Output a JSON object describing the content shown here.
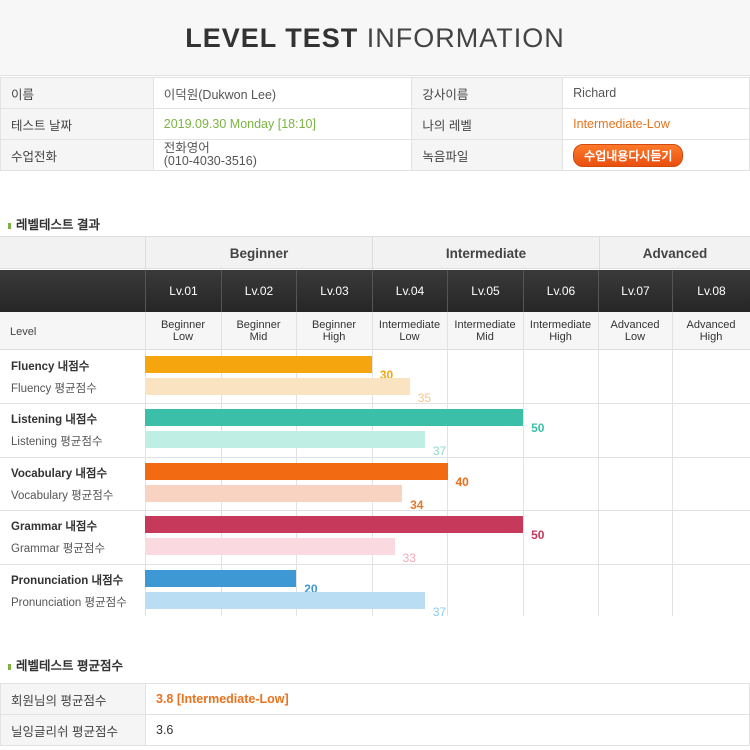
{
  "header": {
    "title_bold": "LEVEL TEST",
    "title_light": "INFORMATION"
  },
  "info": {
    "name_label": "이름",
    "name_value": "이덕원(Dukwon Lee)",
    "teacher_label": "강사이름",
    "teacher_value": "Richard",
    "date_label": "테스트 날짜",
    "date_value": "2019.09.30  Monday [18:10]",
    "mylevel_label": "나의 레벨",
    "mylevel_value": "Intermediate-Low",
    "phone_label": "수업전화",
    "phone_value_line1": "전화영어",
    "phone_value_line2": "(010-4030-3516)",
    "recording_label": "녹음파일",
    "recording_button": "수업내용다시듣기"
  },
  "result_section_title": "레벨테스트 결과",
  "groups": [
    "Beginner",
    "Intermediate",
    "Advanced"
  ],
  "levels": [
    "Lv.01",
    "Lv.02",
    "Lv.03",
    "Lv.04",
    "Lv.05",
    "Lv.06",
    "Lv.07",
    "Lv.08"
  ],
  "level_row_label": "Level",
  "level_names": [
    [
      "Beginner",
      "Low"
    ],
    [
      "Beginner",
      "Mid"
    ],
    [
      "Beginner",
      "High"
    ],
    [
      "Intermediate",
      "Low"
    ],
    [
      "Intermediate",
      "Mid"
    ],
    [
      "Intermediate",
      "High"
    ],
    [
      "Advanced",
      "Low"
    ],
    [
      "Advanced",
      "High"
    ]
  ],
  "colors": {
    "fluency": "#f5a60f",
    "fluency_avg": "#f9e3c0",
    "listening": "#3bbfa8",
    "listening_avg": "#bfeee4",
    "vocabulary": "#f26a12",
    "vocabulary_avg": "#f8d3c2",
    "grammar": "#c7395a",
    "grammar_avg": "#fbd9e0",
    "pronunciation": "#3d98d3",
    "pronunciation_avg": "#b9def4",
    "fluency_avg_num": "#f7c58a",
    "listening_avg_num": "#8fd9cc",
    "vocabulary_avg_num": "#e07a2e",
    "grammar_avg_num": "#f5aabb",
    "pronunciation_avg_num": "#8ecbef"
  },
  "scale_max": 80,
  "skills": [
    {
      "key": "fluency",
      "mine_label": "Fluency 내점수",
      "avg_label": "Fluency 평균점수",
      "mine": 30,
      "avg": 35
    },
    {
      "key": "listening",
      "mine_label": "Listening 내점수",
      "avg_label": "Listening 평균점수",
      "mine": 50,
      "avg": 37
    },
    {
      "key": "vocabulary",
      "mine_label": "Vocabulary 내점수",
      "avg_label": "Vocabulary 평균점수",
      "mine": 40,
      "avg": 34
    },
    {
      "key": "grammar",
      "mine_label": "Grammar 내점수",
      "avg_label": "Grammar 평균점수",
      "mine": 50,
      "avg": 33
    },
    {
      "key": "pronunciation",
      "mine_label": "Pronunciation 내점수",
      "avg_label": "Pronunciation 평균점수",
      "mine": 20,
      "avg": 37
    }
  ],
  "avg_section_title": "레벨테스트 평균점수",
  "avg": {
    "member_label": "회원님의 평균점수",
    "member_value": "3.8 [Intermediate-Low]",
    "global_label": "닐잉글리쉬 평균점수",
    "global_value": "3.6"
  }
}
